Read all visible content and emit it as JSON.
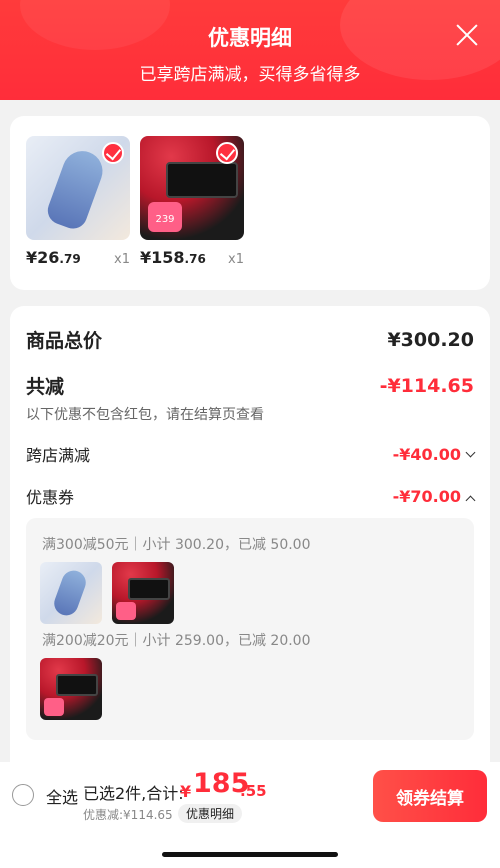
{
  "header": {
    "title": "优惠明细",
    "subtitle": "已享跨店满减，买得多省得多"
  },
  "products": [
    {
      "price_int": "¥26",
      "price_dec": ".79",
      "qty": "x1",
      "checked": true
    },
    {
      "price_int": "¥158",
      "price_dec": ".76",
      "qty": "x1",
      "checked": true,
      "tag": "239"
    }
  ],
  "summary": {
    "total_label": "商品总价",
    "total_value": "¥300.20",
    "discount_label": "共减",
    "discount_value": "-¥114.65",
    "discount_note": "以下优惠不包含红包，请在结算页查看",
    "cross_store_label": "跨店满减",
    "cross_store_value": "-¥40.00",
    "coupon_label": "优惠券",
    "coupon_value": "-¥70.00",
    "coupon_rules": [
      {
        "text": "满300减50元｜小计 300.20，已减 50.00"
      },
      {
        "text": "满200减20元｜小计 259.00，已减 20.00"
      }
    ]
  },
  "bottom": {
    "select_all": "全选",
    "selected_text": "已选2件,合计:",
    "currency": "¥",
    "total_int": "185",
    "total_dec": ".55",
    "saved_text": "优惠减:¥114.65",
    "detail_button": "优惠明细",
    "checkout_button": "领券结算"
  },
  "colors": {
    "accent": "#ff2d3a",
    "header": "#ff3b3b"
  }
}
